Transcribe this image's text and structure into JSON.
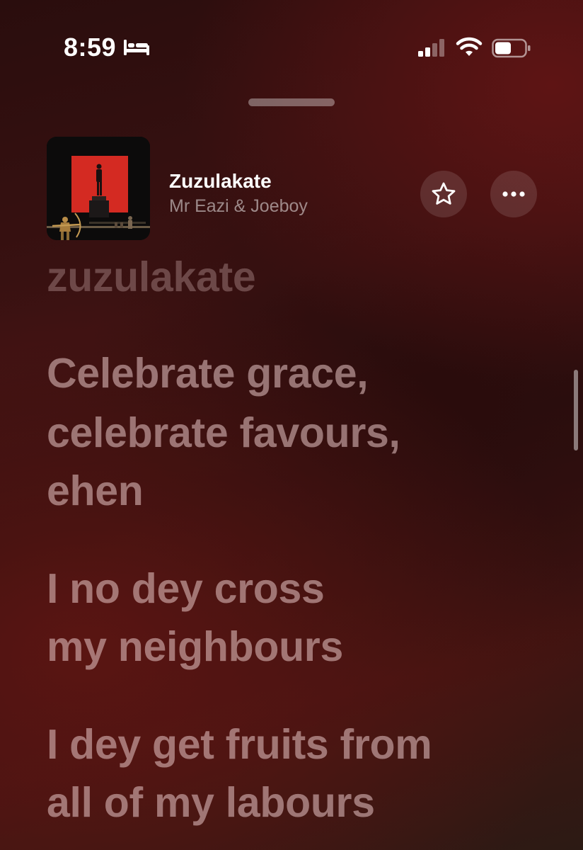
{
  "status_bar": {
    "time": "8:59",
    "sleep_icon": "bed-icon",
    "signal_icon": "cellular-signal-icon",
    "wifi_icon": "wifi-icon",
    "battery_icon": "battery-icon",
    "signal_bars_active": 2,
    "signal_bars_total": 4,
    "battery_level": 0.55
  },
  "now_playing": {
    "title": "Zuzulakate",
    "artist": "Mr Eazi & Joeboy",
    "favorite_icon": "star-outline-icon",
    "more_icon": "ellipsis-icon"
  },
  "lyrics": {
    "previous_line": "zuzulakate",
    "lines": [
      "Celebrate grace,",
      "celebrate favours,",
      "ehen",
      "I no dey cross",
      "my neighbours",
      "I dey get fruits from",
      "all of my labours"
    ]
  },
  "colors": {
    "background_dark": "#2a0d0d",
    "background_red": "#5e1414",
    "lyric_text": "#e8c6c6",
    "album_red": "#d42a22"
  }
}
